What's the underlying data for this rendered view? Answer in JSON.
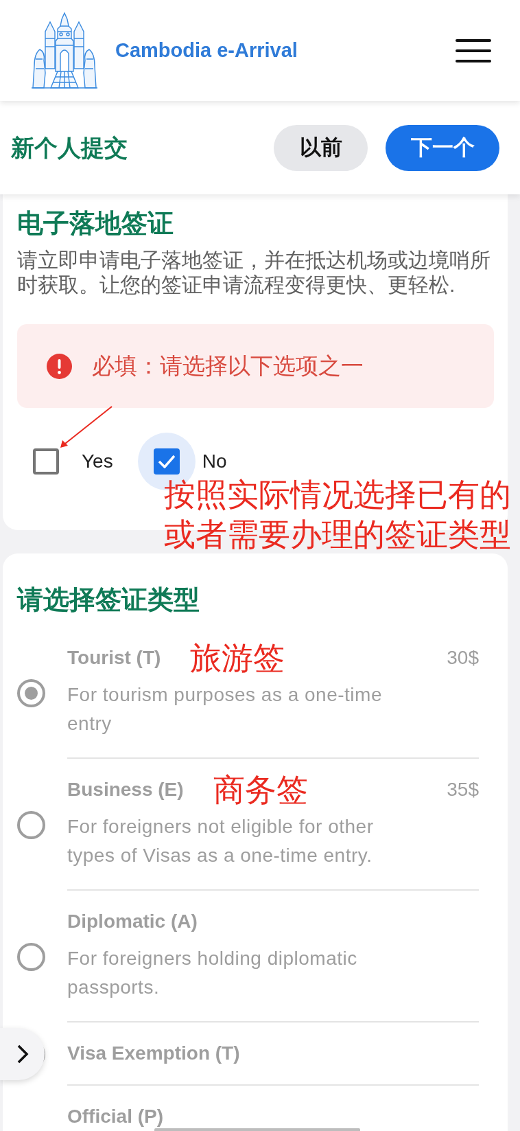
{
  "header": {
    "title": "Cambodia e-Arrival"
  },
  "toolbar": {
    "title": "新个人提交",
    "buttons": [
      {
        "label": "以前",
        "kind": "secondary"
      },
      {
        "label": "下一个",
        "kind": "primary"
      }
    ]
  },
  "evisa": {
    "title": "电子落地签证",
    "description": "请立即申请电子落地签证，并在抵达机场或边境哨所时获取。让您的签证申请流程变得更快、更轻松.",
    "error": "必填：请选择以下选项之一",
    "options": [
      {
        "label": "Yes",
        "checked": false,
        "focused": false
      },
      {
        "label": "No",
        "checked": true,
        "focused": true
      }
    ]
  },
  "annotation_note": {
    "lines": [
      "按照实际情况选择已有的",
      "或者需要办理的签证类型"
    ]
  },
  "visa_types": {
    "title": "请选择签证类型",
    "options": [
      {
        "name": "Tourist (T)",
        "annotation": "旅游签",
        "price": "30$",
        "description": "For tourism purposes as a one-time entry",
        "selected": true,
        "disabled": true,
        "clipped": false
      },
      {
        "name": "Business (E)",
        "annotation": "商务签",
        "price": "35$",
        "description": "For foreigners not eligible for other types of Visas as a one-time entry.",
        "selected": false,
        "disabled": true,
        "clipped": false
      },
      {
        "name": "Diplomatic (A)",
        "description": "For foreigners holding diplomatic passports.",
        "selected": false,
        "disabled": true,
        "clipped": false
      },
      {
        "name": "Visa Exemption (T)",
        "selected": false,
        "disabled": true,
        "clipped": false
      },
      {
        "name": "Official (P)",
        "selected": false,
        "disabled": true,
        "clipped": true
      }
    ]
  }
}
